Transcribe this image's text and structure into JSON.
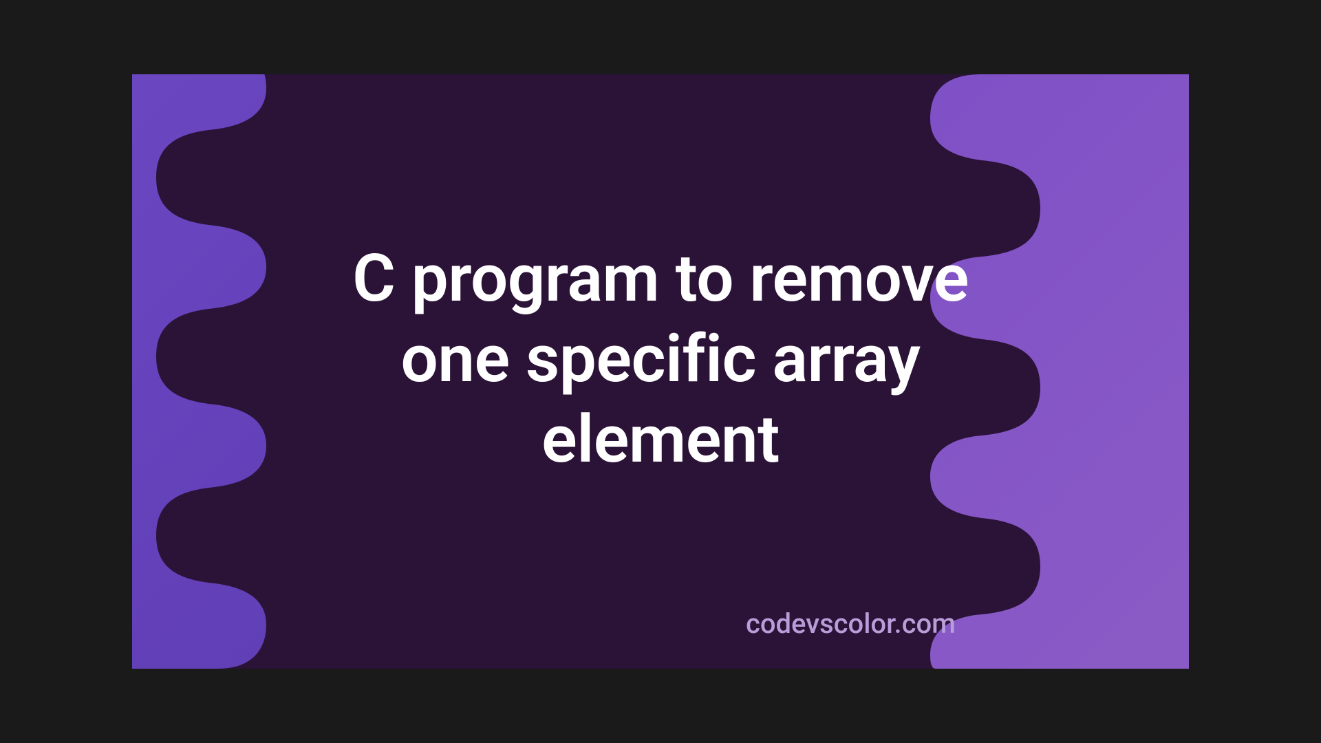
{
  "title": "C program to remove one specific array element",
  "watermark": "codevscolor.com",
  "colors": {
    "blob": "#2b1237",
    "bg_left": "#6b46c1",
    "bg_right": "#8b5bc5",
    "text": "#ffffff",
    "watermark": "#b89dd9"
  }
}
